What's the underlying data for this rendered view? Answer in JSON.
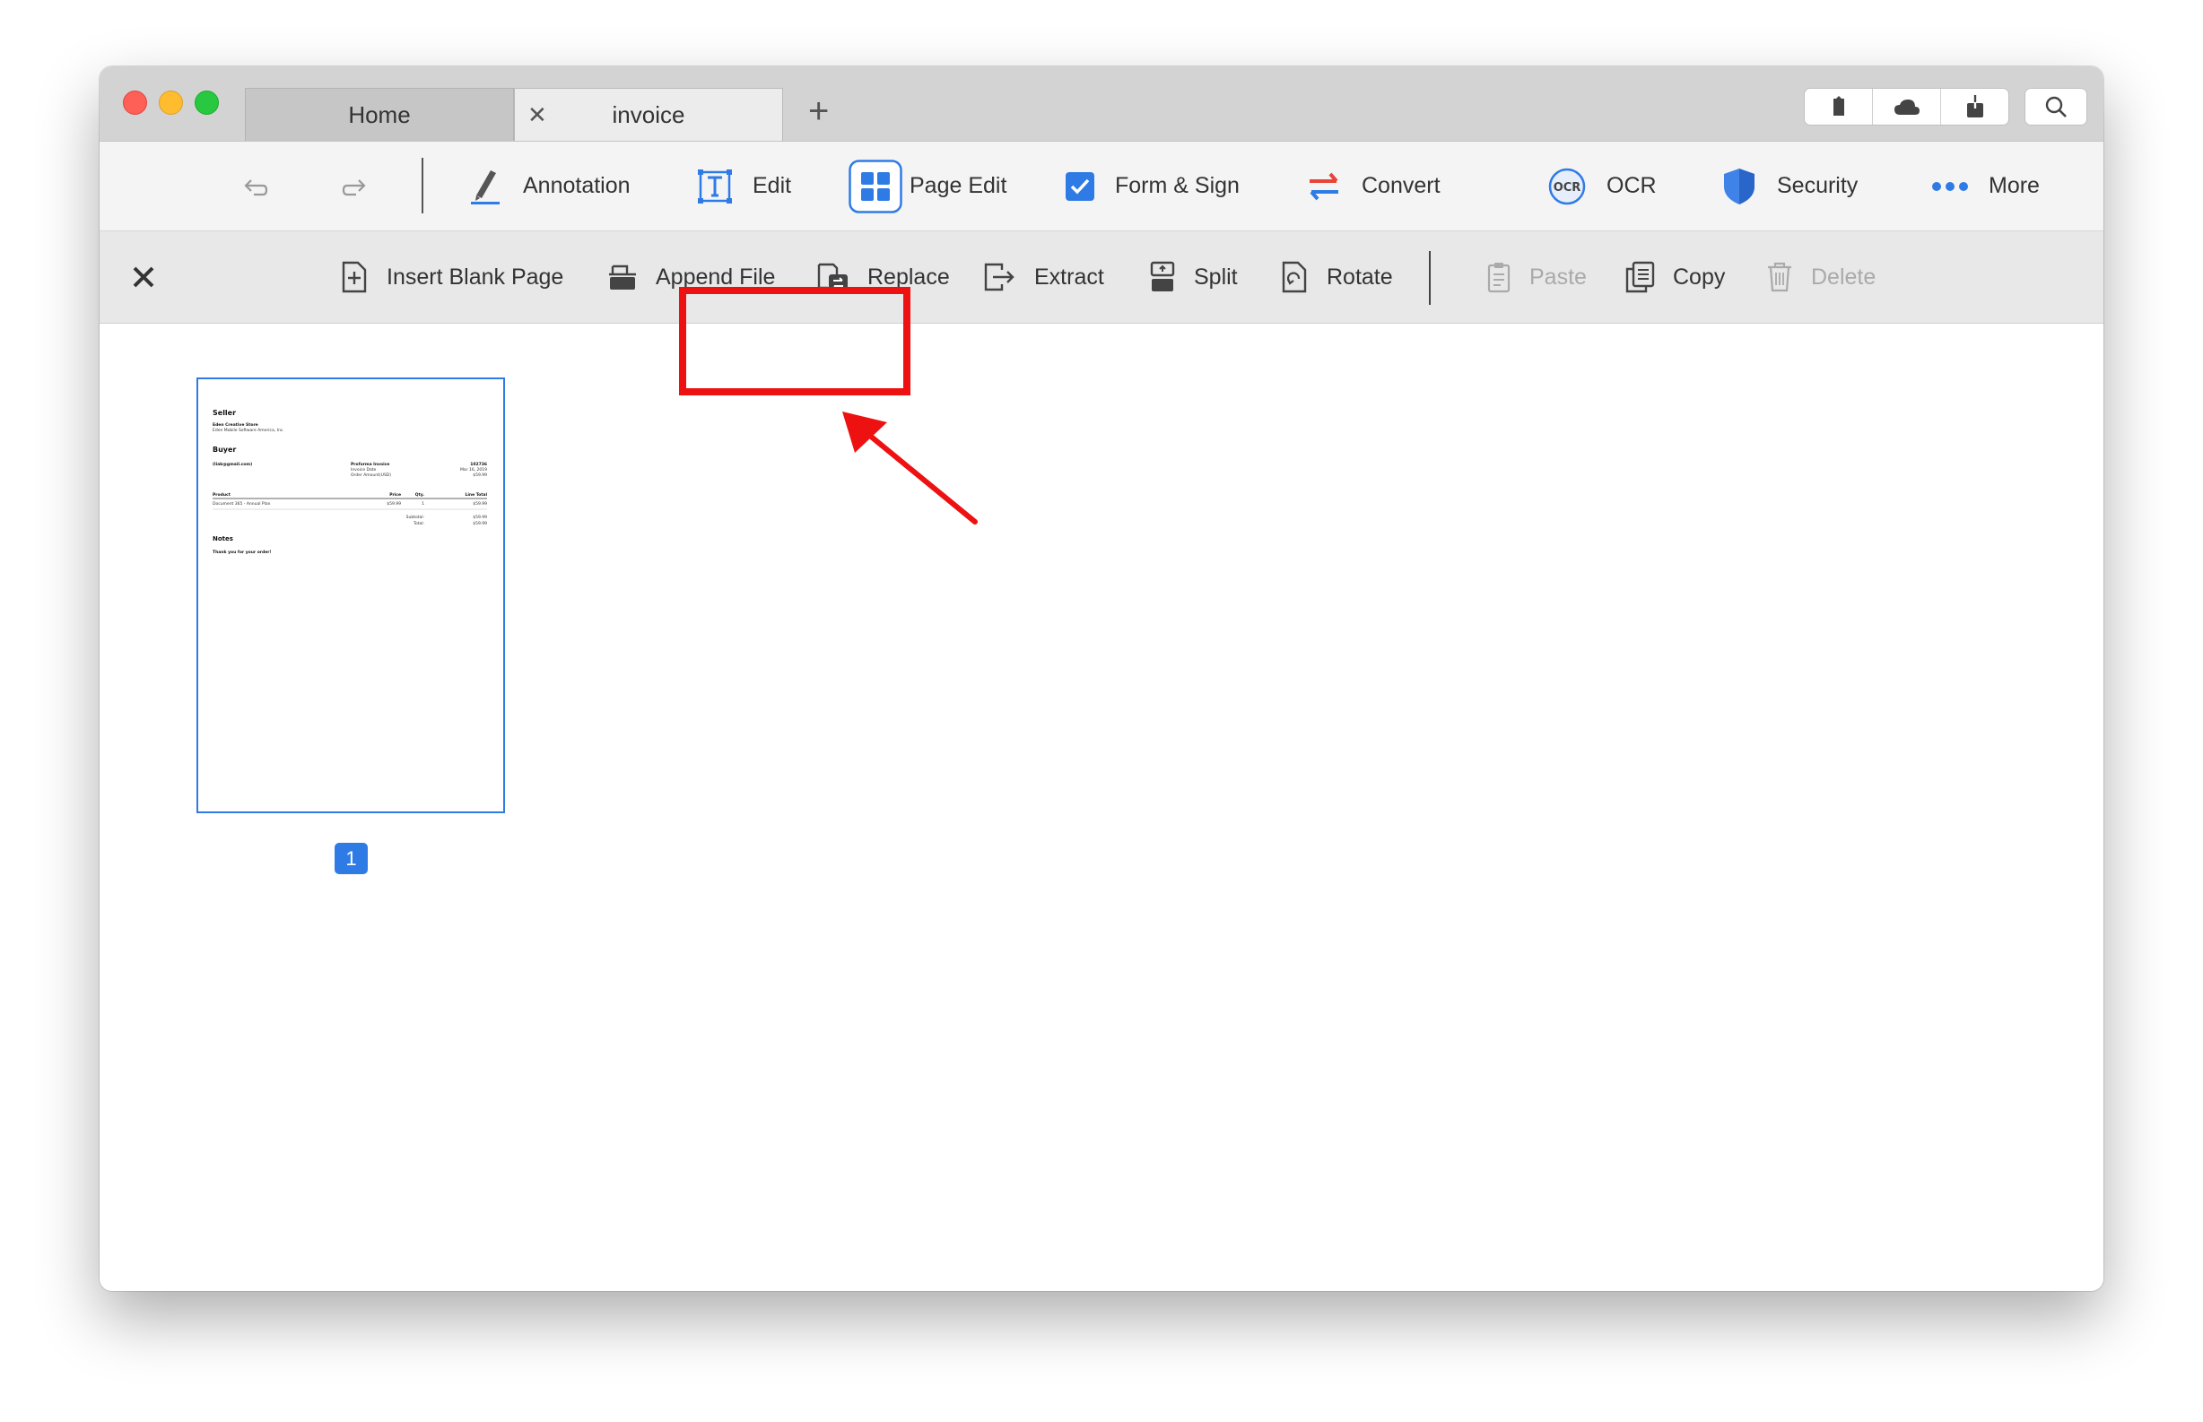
{
  "tabs": {
    "home": "Home",
    "invoice": "invoice",
    "close_symbol": "✕",
    "add_symbol": "+"
  },
  "titlebar_icons": [
    "tag-icon",
    "cloud-icon",
    "share-icon",
    "search-icon"
  ],
  "main_toolbar": {
    "annotation": "Annotation",
    "edit": "Edit",
    "page_edit": "Page Edit",
    "form_sign": "Form & Sign",
    "convert": "Convert",
    "ocr": "OCR",
    "security": "Security",
    "more": "More",
    "ocr_glyph": "OCR"
  },
  "page_toolbar": {
    "insert_blank": "Insert Blank Page",
    "append_file": "Append File",
    "replace": "Replace",
    "extract": "Extract",
    "split": "Split",
    "rotate": "Rotate",
    "paste": "Paste",
    "copy": "Copy",
    "delete": "Delete"
  },
  "thumbnail": {
    "page_number": "1",
    "seller_heading": "Seller",
    "seller_name": "Eden Creative Store",
    "seller_sub": "Eden Mobile Software America, Inc.",
    "buyer_heading": "Buyer",
    "buyer_email": "(liab@gmail.com)",
    "invoice_title": "Proforma Invoice",
    "invoice_no": "102736",
    "invoice_date_label": "Invoice Date",
    "invoice_date": "Mar 16, 2019",
    "order_amount_label": "Order Amount(USD)",
    "order_amount": "$59.99",
    "col_product": "Product",
    "col_price": "Price",
    "col_qty": "Qty.",
    "col_total": "Line Total",
    "row_product": "Document 365 - Annual Plan",
    "row_price": "$59.99",
    "row_qty": "1",
    "row_total": "$59.99",
    "subtotal_label": "Subtotal:",
    "subtotal": "$59.99",
    "total_label": "Total:",
    "total": "$59.99",
    "notes_heading": "Notes",
    "notes_text": "Thank you for your order!"
  },
  "colors": {
    "accent": "#2f7be6",
    "highlight": "#ee1111"
  }
}
